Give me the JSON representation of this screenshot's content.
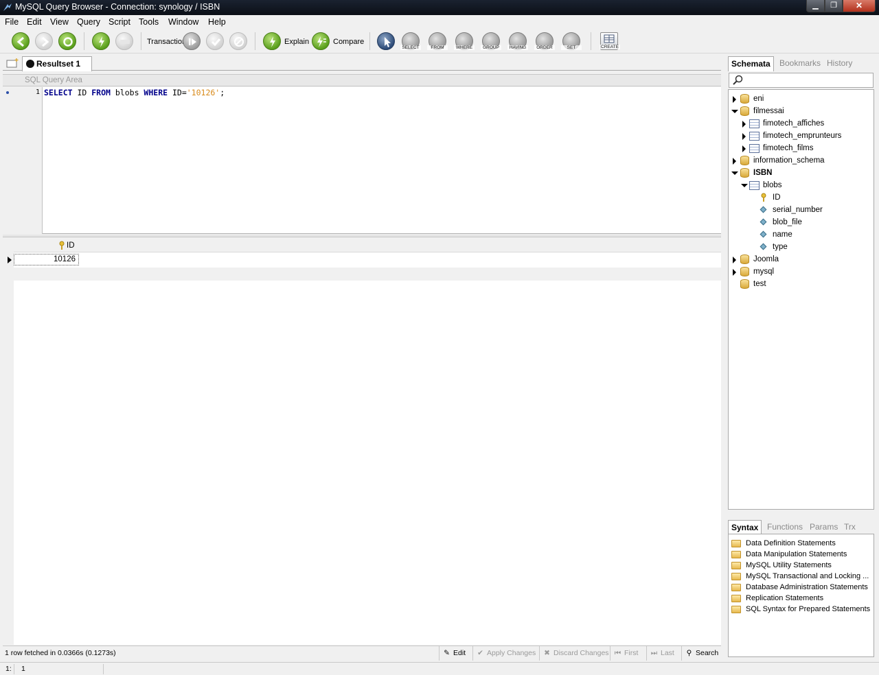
{
  "window": {
    "title": "MySQL Query Browser - Connection: synology / ISBN",
    "minimize": "▁",
    "maximize": "❐",
    "close": "✕"
  },
  "menu": [
    "File",
    "Edit",
    "View",
    "Query",
    "Script",
    "Tools",
    "Window",
    "Help"
  ],
  "toolbar": {
    "transaction_label": "Transaction",
    "explain_label": "Explain",
    "compare_label": "Compare",
    "clause_buttons": [
      "SELECT",
      "FROM",
      "WHERE",
      "GROUP",
      "HAVING",
      "ORDER",
      "SET"
    ],
    "create_label": "CREATE"
  },
  "tabs": {
    "resultset": "Resultset 1"
  },
  "sql_area": {
    "header": "SQL Query Area",
    "line_number": "1",
    "tokens": {
      "k1": "SELECT",
      "t1": " ID ",
      "k2": "FROM",
      "t2": " blobs ",
      "k3": "WHERE",
      "t3": " ID=",
      "s1": "'10126'",
      "t4": ";"
    }
  },
  "result": {
    "columns": [
      "ID"
    ],
    "rows": [
      [
        "10126"
      ]
    ],
    "status": "1 row fetched in 0.0366s (0.1273s)"
  },
  "result_actions": {
    "edit": "Edit",
    "apply": "Apply Changes",
    "discard": "Discard Changes",
    "first": "First",
    "last": "Last",
    "search": "Search"
  },
  "right_tabs": {
    "schemata": "Schemata",
    "bookmarks": "Bookmarks",
    "history": "History"
  },
  "schema_tree": {
    "eni": "eni",
    "filmessai": "filmessai",
    "fimotech_affiches": "fimotech_affiches",
    "fimotech_emprunteurs": "fimotech_emprunteurs",
    "fimotech_films": "fimotech_films",
    "information_schema": "information_schema",
    "isbn": "ISBN",
    "blobs": "blobs",
    "col_id": "ID",
    "col_serial": "serial_number",
    "col_blob": "blob_file",
    "col_name": "name",
    "col_type": "type",
    "joomla": "Joomla",
    "mysql": "mysql",
    "test": "test"
  },
  "syntax_tabs": {
    "syntax": "Syntax",
    "functions": "Functions",
    "params": "Params",
    "trx": "Trx"
  },
  "syntax_items": [
    "Data Definition Statements",
    "Data Manipulation Statements",
    "MySQL Utility Statements",
    "MySQL Transactional and Locking ...",
    "Database Administration Statements",
    "Replication Statements",
    "SQL Syntax for Prepared Statements"
  ],
  "bottom_status": {
    "line": "1:",
    "col": "1"
  }
}
